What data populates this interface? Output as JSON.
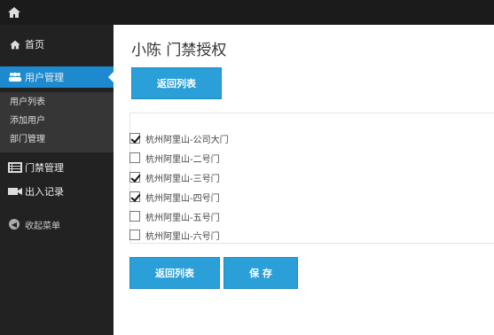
{
  "sidebar": {
    "home_label": "首页",
    "user_mgmt_label": "用户管理",
    "sub_items": [
      "用户列表",
      "添加用户",
      "部门管理"
    ],
    "door_mgmt_label": "门禁管理",
    "access_log_label": "出入记录",
    "collapse_label": "收起菜单"
  },
  "main": {
    "title": "小陈 门禁授权",
    "back_top_label": "返回列表",
    "doors": [
      {
        "label": "杭州阿里山-公司大门",
        "checked": true
      },
      {
        "label": "杭州阿里山-二号门",
        "checked": false
      },
      {
        "label": "杭州阿里山-三号门",
        "checked": true
      },
      {
        "label": "杭州阿里山-四号门",
        "checked": true
      },
      {
        "label": "杭州阿里山-五号门",
        "checked": false
      },
      {
        "label": "杭州阿里山-六号门",
        "checked": false
      }
    ],
    "back_bottom_label": "返回列表",
    "save_label": "保 存"
  },
  "colors": {
    "accent": "#2b9fd7",
    "sidebar_bg": "#222222",
    "topbar_bg": "#1b1b1b",
    "active_nav": "#1d8ad0"
  },
  "icons": [
    "home-icon",
    "users-icon",
    "list-icon",
    "camera-icon",
    "arrow-left-circle-icon"
  ]
}
